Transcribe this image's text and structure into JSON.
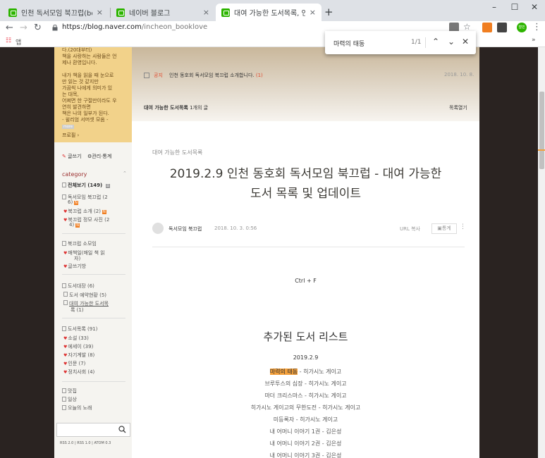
{
  "browser": {
    "tabs": [
      {
        "label": "인천 독서모임 북끄럽(booklove",
        "active": false
      },
      {
        "label": "네이버 블로그",
        "active": false
      },
      {
        "label": "대여 가능한 도서목록, 인천 독서",
        "active": true
      }
    ],
    "close_glyph": "×",
    "new_tab": "+",
    "url_host": "https://blog.naver.com",
    "url_path": "/incheon_booklove",
    "bookmark_label": "앱",
    "more_label": "»",
    "profile_initial": "철민"
  },
  "find": {
    "query": "마력의 태동",
    "count": "1/1"
  },
  "sidebar": {
    "profile_lines": [
      "다.(20대부터)",
      "책을 사랑하는 사람들은 언",
      "제나 환영입니다.",
      "",
      "내가 책을 읽을 때 눈으로",
      "만 읽는 것 같지만",
      "가끔씩 나에게 의미가 있",
      "는 대목,",
      "어쩌면 한 구절만이라도 우",
      "연히 발견하면",
      "책은 나의 일부가 된다.",
      "- 윌리엄 서머셋 모옴 -"
    ],
    "more_tag": "more",
    "profile_link": "프로필 ›",
    "write_label": "글쓰기",
    "manage_label": "관리·통계",
    "category_title": "category",
    "all_posts": "전체보기 (149)",
    "categories": [
      {
        "label": "독서모임 북끄럽 (2",
        "cont": "6)"
      },
      {
        "label": "북끄럽 소개 (2)"
      },
      {
        "label": "북끄럽 정모 사진 (2",
        "cont": "4)"
      },
      {
        "label": "북끄럽 소모임"
      },
      {
        "label": "매책일(매일 책 읽",
        "cont": "자)"
      },
      {
        "label": "글쓰기방"
      },
      {
        "label": "도서대장 (6)"
      },
      {
        "label": "도서 예약현황 (5)"
      },
      {
        "label": "대여 가능한 도서목",
        "cont": "록 (1)"
      },
      {
        "label": "도서목록 (91)"
      },
      {
        "label": "소설 (33)"
      },
      {
        "label": "에세이 (39)"
      },
      {
        "label": "자기계발 (8)"
      },
      {
        "label": "인문 (7)"
      },
      {
        "label": "정치사회 (4)"
      },
      {
        "label": "맛집"
      },
      {
        "label": "일상"
      },
      {
        "label": "오늘의 노래"
      }
    ],
    "new_badge": "N",
    "feeds": "RSS 2.0 | RSS 1.0 | ATOM 0.3"
  },
  "content": {
    "notice_label": "공지",
    "notice_text": "인천 동호회 독서모임 북끄럽 소개합니다.",
    "notice_count": "(1)",
    "notice_date": "2018. 10. 8.",
    "list_category": "대여 가능한 도서목록",
    "list_count": "1개의 글",
    "list_toggle": "목록열기",
    "post_category": "대여 가능한 도서목록",
    "post_title_1": "2019.2.9 인천 동호회 독서모임 북끄럽 - 대여 가능한",
    "post_title_2": "도서 목록 및 업데이트",
    "author": "독서모임 북끄럽",
    "post_date": "2018. 10. 3. 0:56",
    "url_copy": "URL 복사",
    "stats_button": "통계",
    "shortcut_hint": "Ctrl + F",
    "section_title": "추가된 도서 리스트",
    "list_date": "2019.2.9",
    "books": [
      {
        "title": "마력의 태동",
        "author": " - 히가시노 게이고",
        "highlight": true
      },
      {
        "title": "브루투스의 심장",
        "author": " - 히가시노 게이고"
      },
      {
        "title": "마더 크리스마스",
        "author": " - 히가시노 게이고"
      },
      {
        "title": "히가시노 게이고의 무한도전",
        "author": " - 히가시노 게이고"
      },
      {
        "title": "미등록자",
        "author": " - 히가시노 게이고"
      },
      {
        "title": "내 어머니 이야기 1권",
        "author": " - 김은성"
      },
      {
        "title": "내 어머니 이야기 2권",
        "author": " - 김은성"
      },
      {
        "title": "내 어머니 이야기 3권",
        "author": " - 김은성"
      }
    ]
  },
  "colors": {
    "highlight": "#f3a03c",
    "accent_green": "#2db400",
    "notice_red": "#e04b2f"
  }
}
